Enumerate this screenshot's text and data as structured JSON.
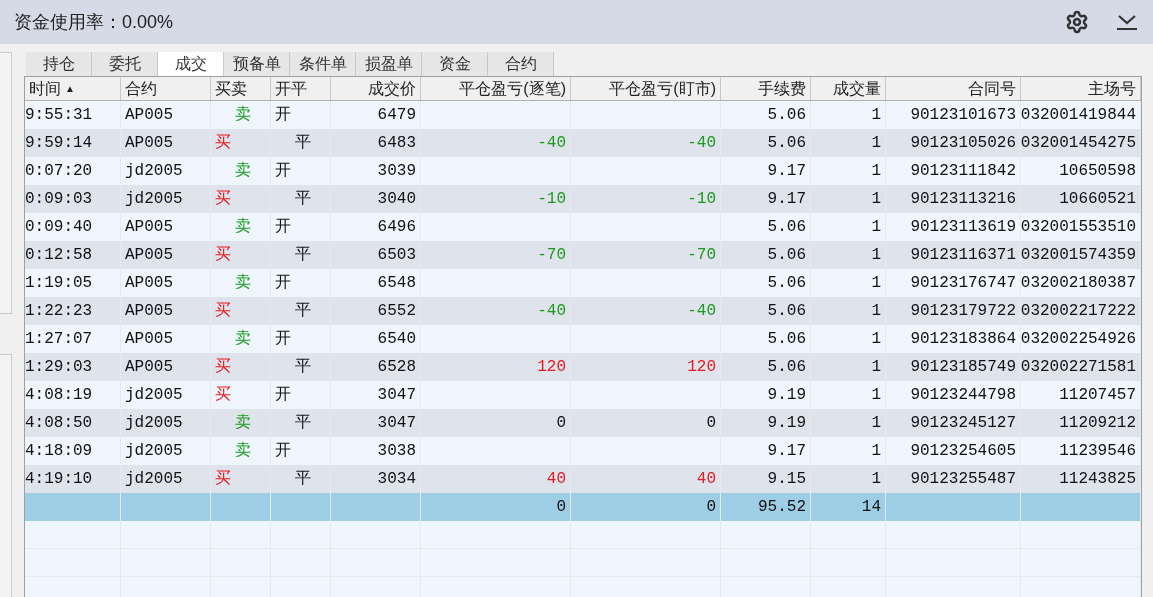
{
  "header": {
    "label": "资金使用率：",
    "value": "0.00%"
  },
  "tabs": [
    {
      "label": "持仓",
      "selected": false
    },
    {
      "label": "委托",
      "selected": false
    },
    {
      "label": "成交",
      "selected": true
    },
    {
      "label": "预备单",
      "selected": false
    },
    {
      "label": "条件单",
      "selected": false
    },
    {
      "label": "损盈单",
      "selected": false
    },
    {
      "label": "资金",
      "selected": false
    },
    {
      "label": "合约",
      "selected": false
    }
  ],
  "table": {
    "columns": [
      {
        "label": "时间",
        "sort_mark": "▲"
      },
      {
        "label": "合约"
      },
      {
        "label": "买卖"
      },
      {
        "label": "开平"
      },
      {
        "label": "成交价"
      },
      {
        "label": "平仓盈亏(逐笔)"
      },
      {
        "label": "平仓盈亏(盯市)"
      },
      {
        "label": "手续费"
      },
      {
        "label": "成交量"
      },
      {
        "label": "合同号"
      },
      {
        "label": "主场号"
      }
    ],
    "rows": [
      {
        "time": "9:55:31",
        "contract": "AP005",
        "side": {
          "kind": "sell",
          "text": "卖"
        },
        "offset": {
          "kind": "open",
          "text": "开"
        },
        "price": "6479",
        "pnl_trade": null,
        "pnl_mark": null,
        "fee": "5.06",
        "qty": "1",
        "order_no": "90123101673",
        "exchange_no": "032001419844"
      },
      {
        "time": "9:59:14",
        "contract": "AP005",
        "side": {
          "kind": "buy",
          "text": "买"
        },
        "offset": {
          "kind": "close",
          "text": "平"
        },
        "price": "6483",
        "pnl_trade": {
          "color": "#1a9a1a",
          "text": "-40"
        },
        "pnl_mark": {
          "color": "#1a9a1a",
          "text": "-40"
        },
        "fee": "5.06",
        "qty": "1",
        "order_no": "90123105026",
        "exchange_no": "032001454275"
      },
      {
        "time": "0:07:20",
        "contract": "jd2005",
        "side": {
          "kind": "sell",
          "text": "卖"
        },
        "offset": {
          "kind": "open",
          "text": "开"
        },
        "price": "3039",
        "pnl_trade": null,
        "pnl_mark": null,
        "fee": "9.17",
        "qty": "1",
        "order_no": "90123111842",
        "exchange_no": "10650598"
      },
      {
        "time": "0:09:03",
        "contract": "jd2005",
        "side": {
          "kind": "buy",
          "text": "买"
        },
        "offset": {
          "kind": "close",
          "text": "平"
        },
        "price": "3040",
        "pnl_trade": {
          "color": "#1a9a1a",
          "text": "-10"
        },
        "pnl_mark": {
          "color": "#1a9a1a",
          "text": "-10"
        },
        "fee": "9.17",
        "qty": "1",
        "order_no": "90123113216",
        "exchange_no": "10660521"
      },
      {
        "time": "0:09:40",
        "contract": "AP005",
        "side": {
          "kind": "sell",
          "text": "卖"
        },
        "offset": {
          "kind": "open",
          "text": "开"
        },
        "price": "6496",
        "pnl_trade": null,
        "pnl_mark": null,
        "fee": "5.06",
        "qty": "1",
        "order_no": "90123113619",
        "exchange_no": "032001553510"
      },
      {
        "time": "0:12:58",
        "contract": "AP005",
        "side": {
          "kind": "buy",
          "text": "买"
        },
        "offset": {
          "kind": "close",
          "text": "平"
        },
        "price": "6503",
        "pnl_trade": {
          "color": "#1a9a1a",
          "text": "-70"
        },
        "pnl_mark": {
          "color": "#1a9a1a",
          "text": "-70"
        },
        "fee": "5.06",
        "qty": "1",
        "order_no": "90123116371",
        "exchange_no": "032001574359"
      },
      {
        "time": "1:19:05",
        "contract": "AP005",
        "side": {
          "kind": "sell",
          "text": "卖"
        },
        "offset": {
          "kind": "open",
          "text": "开"
        },
        "price": "6548",
        "pnl_trade": null,
        "pnl_mark": null,
        "fee": "5.06",
        "qty": "1",
        "order_no": "90123176747",
        "exchange_no": "032002180387"
      },
      {
        "time": "1:22:23",
        "contract": "AP005",
        "side": {
          "kind": "buy",
          "text": "买"
        },
        "offset": {
          "kind": "close",
          "text": "平"
        },
        "price": "6552",
        "pnl_trade": {
          "color": "#1a9a1a",
          "text": "-40"
        },
        "pnl_mark": {
          "color": "#1a9a1a",
          "text": "-40"
        },
        "fee": "5.06",
        "qty": "1",
        "order_no": "90123179722",
        "exchange_no": "032002217222"
      },
      {
        "time": "1:27:07",
        "contract": "AP005",
        "side": {
          "kind": "sell",
          "text": "卖"
        },
        "offset": {
          "kind": "open",
          "text": "开"
        },
        "price": "6540",
        "pnl_trade": null,
        "pnl_mark": null,
        "fee": "5.06",
        "qty": "1",
        "order_no": "90123183864",
        "exchange_no": "032002254926"
      },
      {
        "time": "1:29:03",
        "contract": "AP005",
        "side": {
          "kind": "buy",
          "text": "买"
        },
        "offset": {
          "kind": "close",
          "text": "平"
        },
        "price": "6528",
        "pnl_trade": {
          "color": "#e8191e",
          "text": "120"
        },
        "pnl_mark": {
          "color": "#e8191e",
          "text": "120"
        },
        "fee": "5.06",
        "qty": "1",
        "order_no": "90123185749",
        "exchange_no": "032002271581"
      },
      {
        "time": "4:08:19",
        "contract": "jd2005",
        "side": {
          "kind": "buy",
          "text": "买"
        },
        "offset": {
          "kind": "open",
          "text": "开"
        },
        "price": "3047",
        "pnl_trade": null,
        "pnl_mark": null,
        "fee": "9.19",
        "qty": "1",
        "order_no": "90123244798",
        "exchange_no": "11207457"
      },
      {
        "time": "4:08:50",
        "contract": "jd2005",
        "side": {
          "kind": "sell",
          "text": "卖"
        },
        "offset": {
          "kind": "close",
          "text": "平"
        },
        "price": "3047",
        "pnl_trade": {
          "color": "#111111",
          "text": "0"
        },
        "pnl_mark": {
          "color": "#111111",
          "text": "0"
        },
        "fee": "9.19",
        "qty": "1",
        "order_no": "90123245127",
        "exchange_no": "11209212"
      },
      {
        "time": "4:18:09",
        "contract": "jd2005",
        "side": {
          "kind": "sell",
          "text": "卖"
        },
        "offset": {
          "kind": "open",
          "text": "开"
        },
        "price": "3038",
        "pnl_trade": null,
        "pnl_mark": null,
        "fee": "9.17",
        "qty": "1",
        "order_no": "90123254605",
        "exchange_no": "11239546"
      },
      {
        "time": "4:19:10",
        "contract": "jd2005",
        "side": {
          "kind": "buy",
          "text": "买"
        },
        "offset": {
          "kind": "close",
          "text": "平"
        },
        "price": "3034",
        "pnl_trade": {
          "color": "#e8191e",
          "text": "40"
        },
        "pnl_mark": {
          "color": "#e8191e",
          "text": "40"
        },
        "fee": "9.15",
        "qty": "1",
        "order_no": "90123255487",
        "exchange_no": "11243825"
      }
    ],
    "totals": {
      "pnl_trade": "0",
      "pnl_mark": "0",
      "fee": "95.52",
      "qty": "14"
    }
  }
}
